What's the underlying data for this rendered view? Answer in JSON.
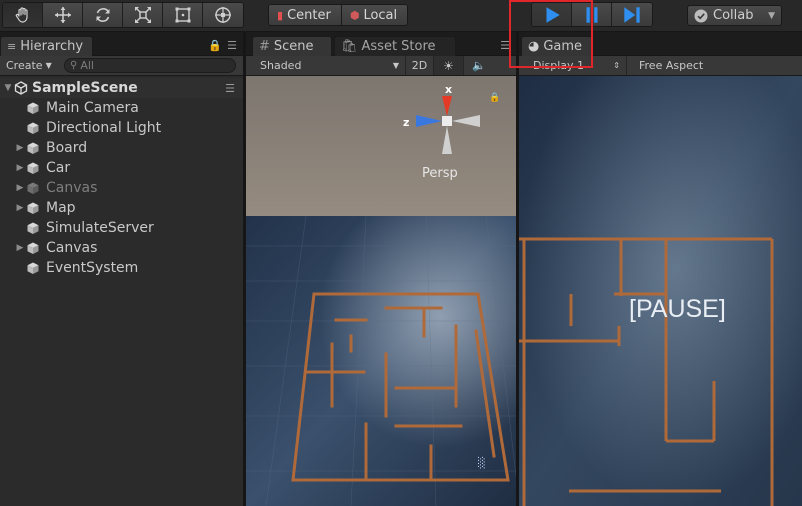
{
  "toolbar": {
    "transform_tools": [
      "hand-tool",
      "move-tool",
      "rotate-tool",
      "scale-tool",
      "rect-tool",
      "transform-tool"
    ],
    "pivot_label": "Center",
    "space_label": "Local",
    "play_controls": [
      "play",
      "pause",
      "step"
    ],
    "collab_label": "Collab"
  },
  "hierarchy": {
    "tab_label": "Hierarchy",
    "create_label": "Create",
    "search_placeholder": "All",
    "scene_name": "SampleScene",
    "items": [
      {
        "label": "Main Camera",
        "expandable": false,
        "enabled": true
      },
      {
        "label": "Directional Light",
        "expandable": false,
        "enabled": true
      },
      {
        "label": "Board",
        "expandable": true,
        "enabled": true
      },
      {
        "label": "Car",
        "expandable": true,
        "enabled": true
      },
      {
        "label": "Canvas",
        "expandable": true,
        "enabled": false
      },
      {
        "label": "Map",
        "expandable": true,
        "enabled": true
      },
      {
        "label": "SimulateServer",
        "expandable": false,
        "enabled": true
      },
      {
        "label": "Canvas",
        "expandable": true,
        "enabled": true
      },
      {
        "label": "EventSystem",
        "expandable": false,
        "enabled": true
      }
    ]
  },
  "scene": {
    "tab_label": "Scene",
    "asset_store_label": "Asset Store",
    "shading_mode": "Shaded",
    "toggle_2d": "2D",
    "gizmo_x": "x",
    "gizmo_z": "z",
    "persp_label": "Persp"
  },
  "game": {
    "tab_label": "Game",
    "display_label": "Display 1",
    "aspect_label": "Free Aspect",
    "overlay_text": "[PAUSE]"
  },
  "colors": {
    "play_blue": "#2f8ff0",
    "highlight_red": "#e0262b",
    "maze_wall": "#b06a3a",
    "background_sky": "#8a8178",
    "board_blue": "#2c3c54"
  }
}
